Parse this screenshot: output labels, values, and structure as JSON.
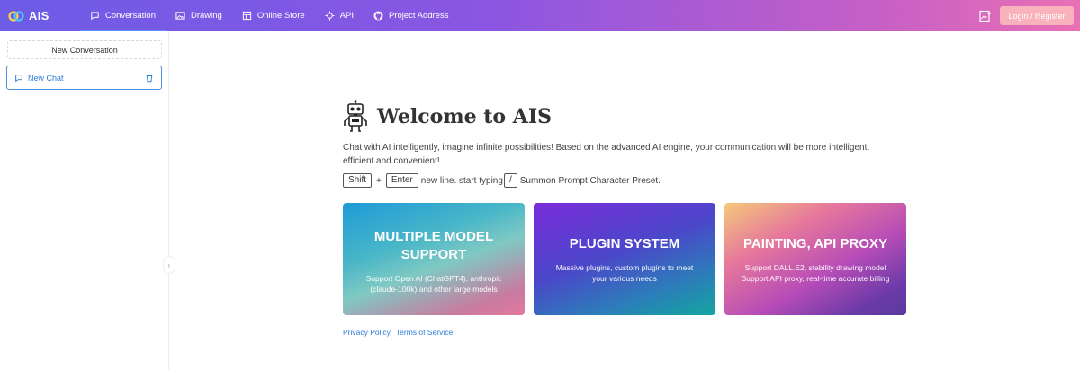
{
  "header": {
    "brand": "AIS",
    "nav": [
      {
        "label": "Conversation",
        "icon": "chat-icon",
        "active": true
      },
      {
        "label": "Drawing",
        "icon": "image-icon"
      },
      {
        "label": "Online Store",
        "icon": "store-icon"
      },
      {
        "label": "API",
        "icon": "api-icon"
      },
      {
        "label": "Project Address",
        "icon": "github-icon"
      }
    ],
    "login_label": "Login / Register"
  },
  "sidebar": {
    "new_conversation_label": "New Conversation",
    "chats": [
      {
        "label": "New Chat"
      }
    ]
  },
  "main": {
    "welcome_title": "Welcome to AIS",
    "intro": "Chat with AI intelligently, imagine infinite possibilities! Based on the advanced AI engine, your communication will be more intelligent, efficient and convenient!",
    "hint": {
      "key1": "Shift",
      "plus": "+",
      "key2": "Enter",
      "text1": "new line. start typing",
      "key3": "/",
      "text2": "Summon Prompt Character Preset."
    },
    "cards": [
      {
        "title": "MULTIPLE MODEL SUPPORT",
        "desc": "Support Open AI (ChatGPT4), anthropic (claude-100k) and other large models"
      },
      {
        "title": "PLUGIN SYSTEM",
        "desc": "Massive plugins, custom plugins to meet your various needs"
      },
      {
        "title": "PAINTING, API PROXY",
        "desc": "Support DALL.E2, stability drawing model Support API proxy, real-time accurate billing"
      }
    ],
    "footer": {
      "privacy": "Privacy Policy",
      "terms": "Terms of Service"
    }
  },
  "colors": {
    "accent": "#2d7cd6",
    "login_button": "#f9b2bc"
  }
}
